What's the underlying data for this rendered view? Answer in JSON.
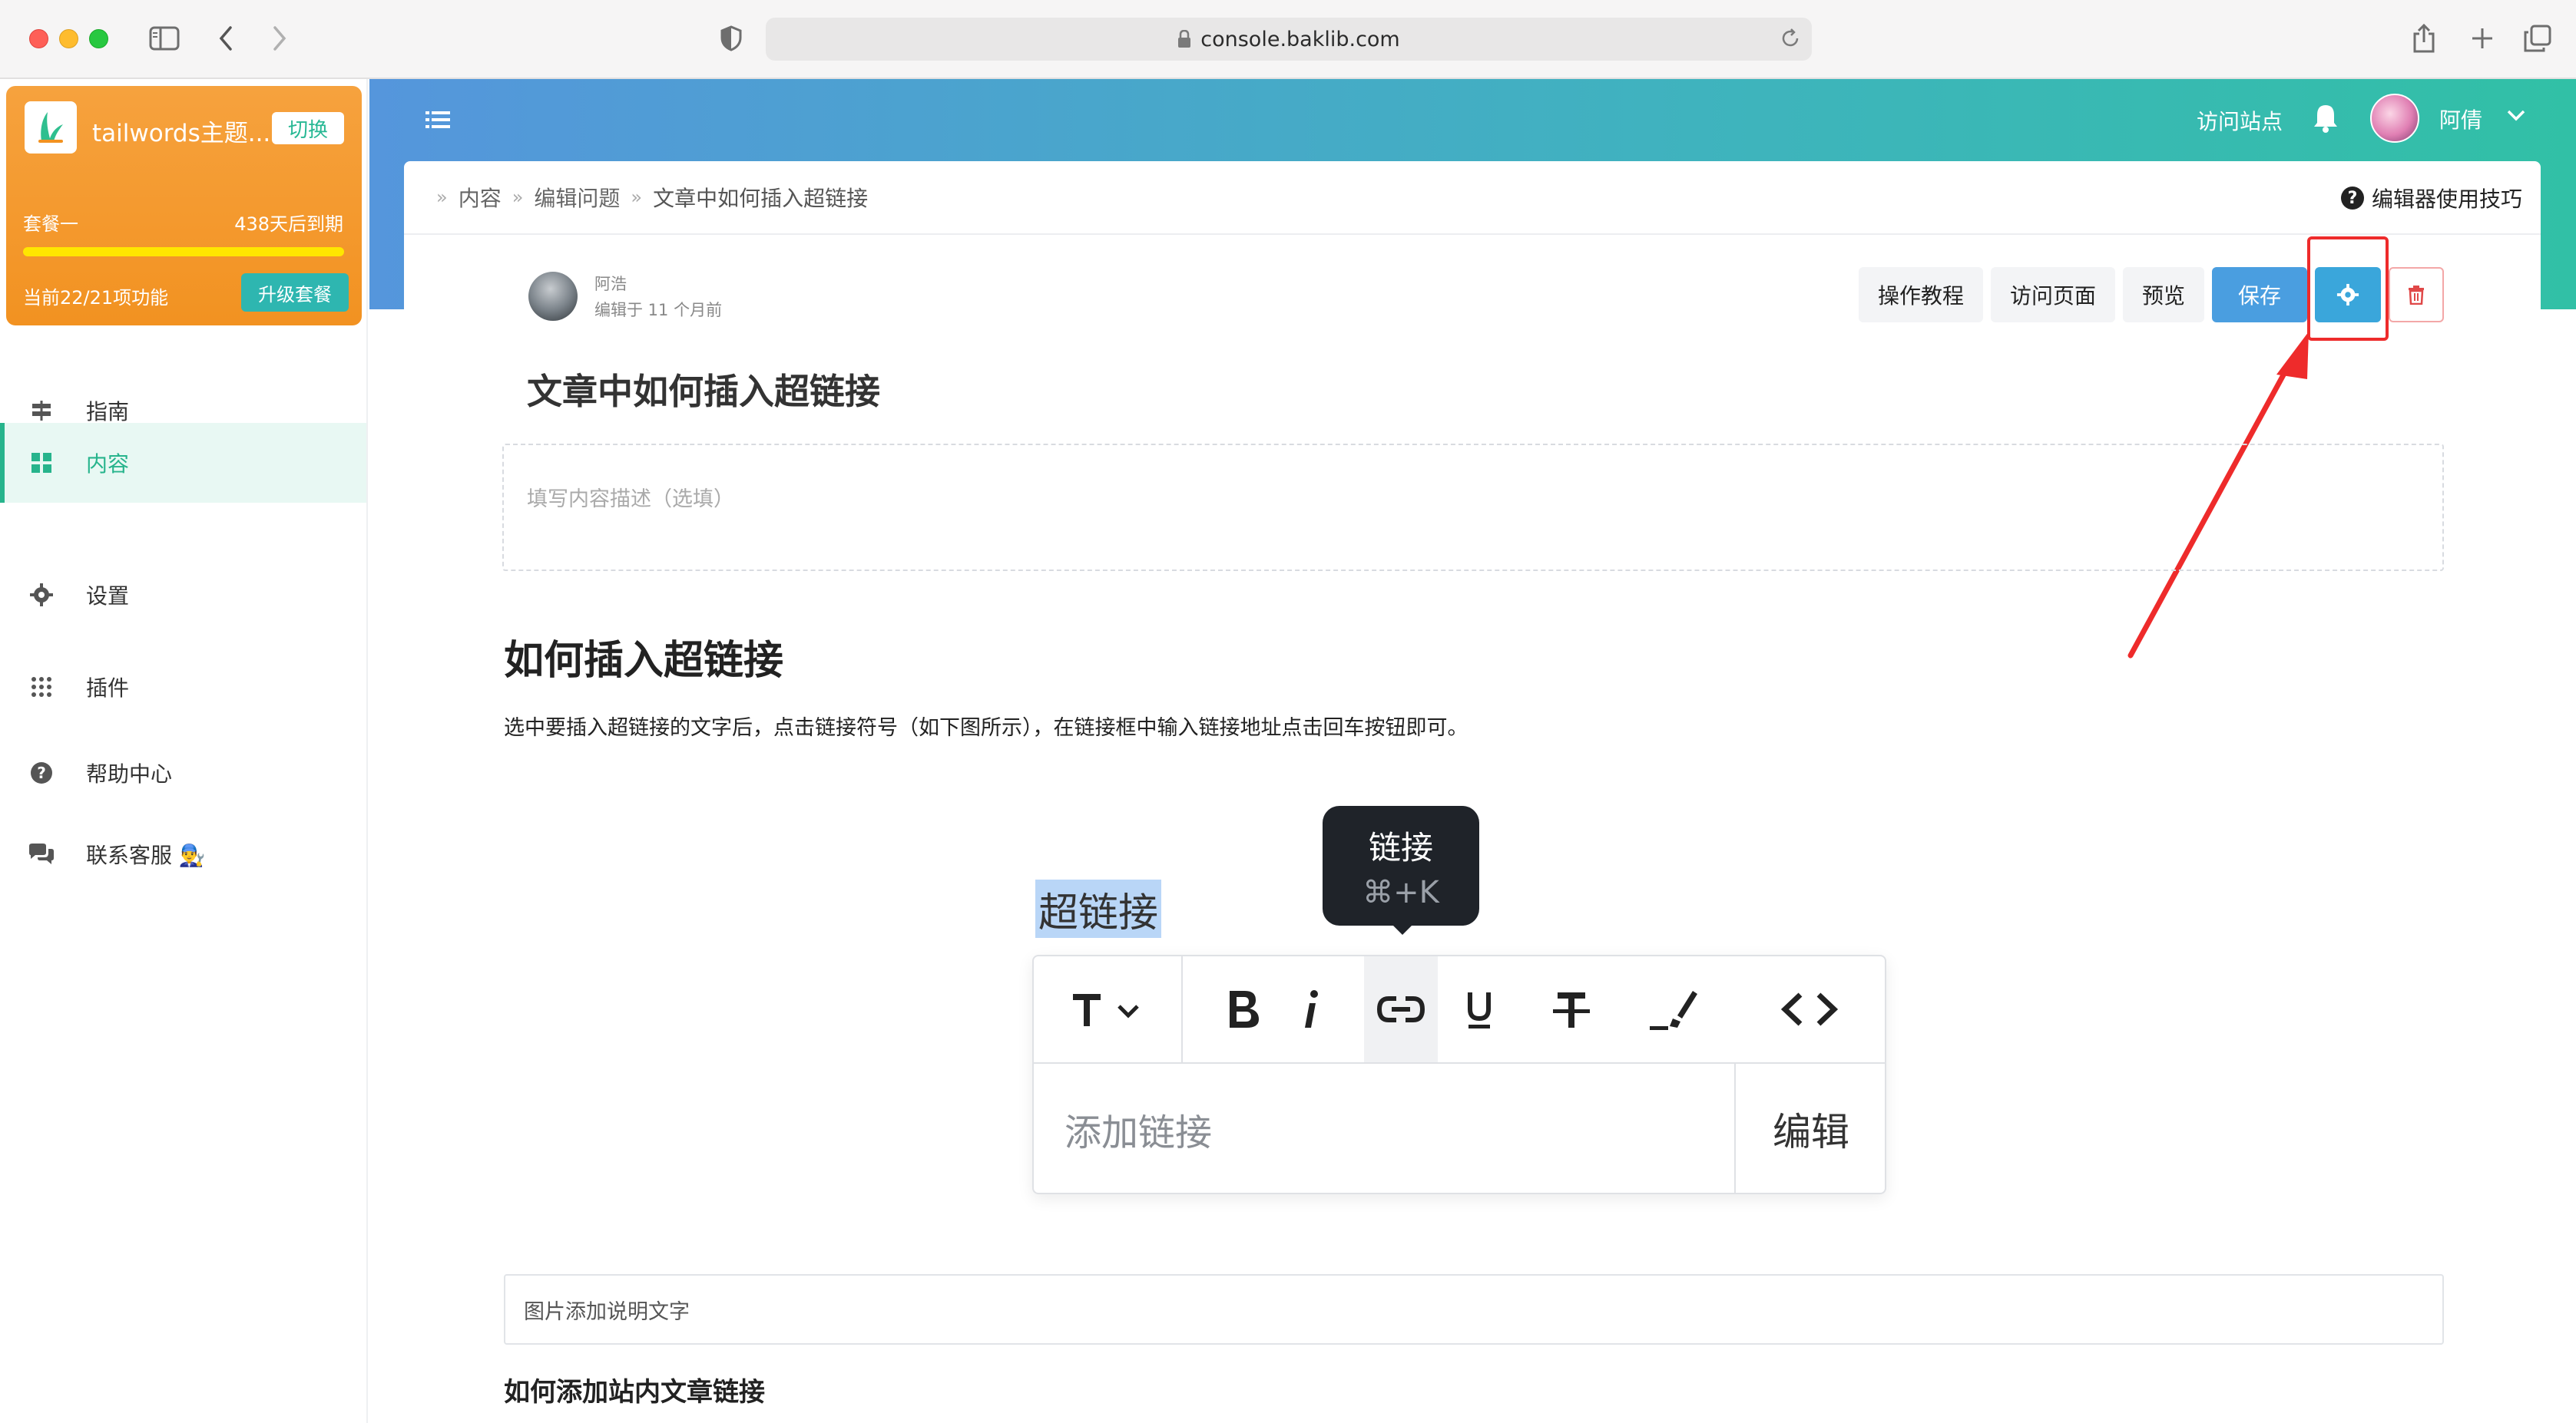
{
  "browser": {
    "url": "console.baklib.com"
  },
  "sidebar": {
    "site_name": "tailwords主题...",
    "switch_label": "切换",
    "plan_name": "套餐一",
    "expire_text": "438天后到期",
    "plan_progress": 1.0,
    "feature_count": "当前22/21项功能",
    "upgrade_label": "升级套餐",
    "items": [
      {
        "label": "指南",
        "icon": "signpost-icon"
      },
      {
        "label": "内容",
        "icon": "grid-icon",
        "active": true
      },
      {
        "label": "设置",
        "icon": "gear-icon"
      },
      {
        "label": "插件",
        "icon": "dots-grid-icon"
      },
      {
        "label": "帮助中心",
        "icon": "help-icon"
      },
      {
        "label": "联系客服 👨‍🔧",
        "icon": "chat-icon"
      }
    ]
  },
  "header": {
    "visit_site": "访问站点",
    "user_name": "阿倩"
  },
  "breadcrumb": {
    "items": [
      "内容",
      "编辑问题",
      "文章中如何插入超链接"
    ],
    "tips": "编辑器使用技巧"
  },
  "article": {
    "author": "阿浩",
    "edited": "编辑于 11 个月前",
    "title": "文章中如何插入超链接",
    "desc_placeholder": "填写内容描述（选填）",
    "heading": "如何插入超链接",
    "paragraph": "选中要插入超链接的文字后，点击链接符号（如下图所示），在链接框中输入链接地址点击回车按钮即可。",
    "caption": "图片添加说明文字",
    "subheading": "如何添加站内文章链接"
  },
  "toolbar": {
    "tutorial": "操作教程",
    "visit_page": "访问页面",
    "preview": "预览",
    "save": "保存"
  },
  "figure": {
    "selected_word": "超链接",
    "tooltip_title": "链接",
    "tooltip_keys": "⌘+K",
    "link_placeholder": "添加链接",
    "edit_label": "编辑"
  },
  "colors": {
    "accent": "#27b48c",
    "brand_blue": "#4a9ee0",
    "highlight_red": "#ee2b2b"
  }
}
